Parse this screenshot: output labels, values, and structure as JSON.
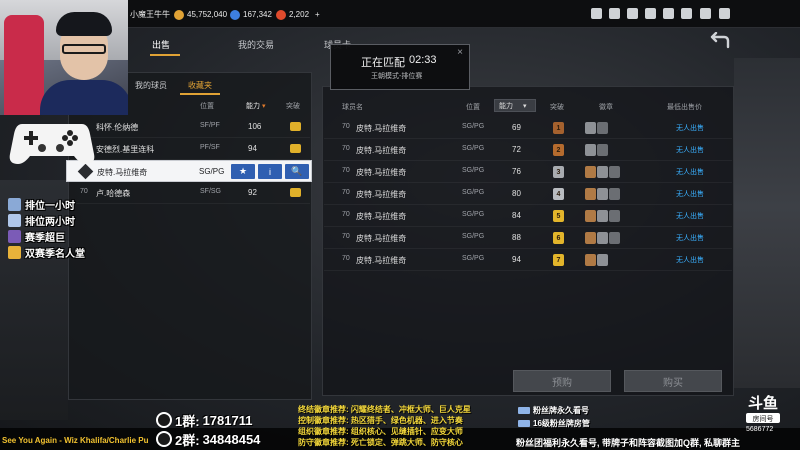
{
  "topbar": {
    "username": "小魔王牛牛",
    "currencies": [
      {
        "value": "45,752,040",
        "color": "#e0a235"
      },
      {
        "value": "167,342",
        "color": "#3d7fe0"
      },
      {
        "value": "2,202",
        "color": "#e04b2d"
      }
    ],
    "plus": "+",
    "icons": [
      "bell-icon",
      "user-icon",
      "mail-icon",
      "video-icon",
      "grid-icon",
      "shield-icon",
      "headset-icon",
      "gear-icon"
    ]
  },
  "tabs": [
    {
      "label": "出售"
    },
    {
      "label": "我的交易"
    },
    {
      "label": "球员卡"
    }
  ],
  "left": {
    "subtabs": [
      "我的球员",
      "收藏夹"
    ],
    "headers": {
      "pos": "位置",
      "rating": "能力",
      "badge": "突破"
    },
    "rows": [
      {
        "card": "",
        "name": "科怀.伦纳德",
        "pos": "SF/PF",
        "rating": "106",
        "badge": true
      },
      {
        "card": "",
        "name": "安德烈.基里连科",
        "pos": "PF/SF",
        "rating": "94",
        "badge": true
      },
      {
        "card": "70",
        "name": "卢.哈德森",
        "pos": "SF/SG",
        "rating": "92",
        "badge": true
      }
    ],
    "highlight": {
      "name": "皮特.马拉维奇",
      "pos": "SG/PG",
      "buttons": [
        "★",
        "i",
        "🔍"
      ]
    }
  },
  "overlay_menu": [
    {
      "label": "排位一小时",
      "icon_color": "#8aa9d6"
    },
    {
      "label": "排位两小时",
      "icon_color": "#b0c7ea"
    },
    {
      "label": "赛季超巨",
      "icon_color": "#7b5bb7"
    },
    {
      "label": "双赛季名人堂",
      "icon_color": "#e8b23a"
    }
  ],
  "right": {
    "headers": {
      "name": "球员名",
      "pos": "位置",
      "sort": "能力",
      "break": "突破",
      "badges": "徽章",
      "price": "最低出售价"
    },
    "rows": [
      {
        "card": "70",
        "name": "皮特.马拉维奇",
        "pos": "SG/PG",
        "rating": "69",
        "break": "1",
        "break_color": "#a5612e",
        "price": "无人出售"
      },
      {
        "card": "70",
        "name": "皮特.马拉维奇",
        "pos": "SG/PG",
        "rating": "72",
        "break": "2",
        "break_color": "#b56b2e",
        "price": "无人出售"
      },
      {
        "card": "70",
        "name": "皮特.马拉维奇",
        "pos": "SG/PG",
        "rating": "76",
        "break": "3",
        "break_color": "#a8abb0",
        "price": "无人出售"
      },
      {
        "card": "70",
        "name": "皮特.马拉维奇",
        "pos": "SG/PG",
        "rating": "80",
        "break": "4",
        "break_color": "#b9bcc1",
        "price": "无人出售"
      },
      {
        "card": "70",
        "name": "皮特.马拉维奇",
        "pos": "SG/PG",
        "rating": "84",
        "break": "5",
        "break_color": "#e3b52b",
        "price": "无人出售"
      },
      {
        "card": "70",
        "name": "皮特.马拉维奇",
        "pos": "SG/PG",
        "rating": "88",
        "break": "6",
        "break_color": "#e3b52b",
        "price": "无人出售"
      },
      {
        "card": "70",
        "name": "皮特.马拉维奇",
        "pos": "SG/PG",
        "rating": "94",
        "break": "7",
        "break_color": "#e3b52b",
        "price": "无人出售"
      }
    ],
    "buttons": {
      "predict": "预购",
      "buy": "购买"
    }
  },
  "popup": {
    "title": "正在匹配",
    "timer": "02:33",
    "mode": "王朝模式-排位赛",
    "close": "×"
  },
  "stream": {
    "song": "See You Again - Wiz Khalifa/Charlie Pu",
    "qq_groups": [
      {
        "label": "1群:",
        "number": "1781711"
      },
      {
        "label": "2群:",
        "number": "34848454"
      }
    ],
    "badge_lines": [
      "终结徽章推荐: 闪耀终结者、冲框大师、巨人克星",
      "控制徽章推荐: 热区猎手、绿色机器、进入节奏",
      "组织徽章推荐: 组织核心、见缝插针、应变大师",
      "防守徽章推荐: 死亡锁定、弹跳大师、防守核心"
    ],
    "fan_lines": [
      "粉丝牌永久看号",
      "16级粉丝牌房管"
    ],
    "fan_notice": "粉丝团福利永久看号, 带牌子和阵容截图加Q群, 私聊群主",
    "platform": "斗鱼",
    "platform_sub": "房间号",
    "room_no": "5686772"
  }
}
